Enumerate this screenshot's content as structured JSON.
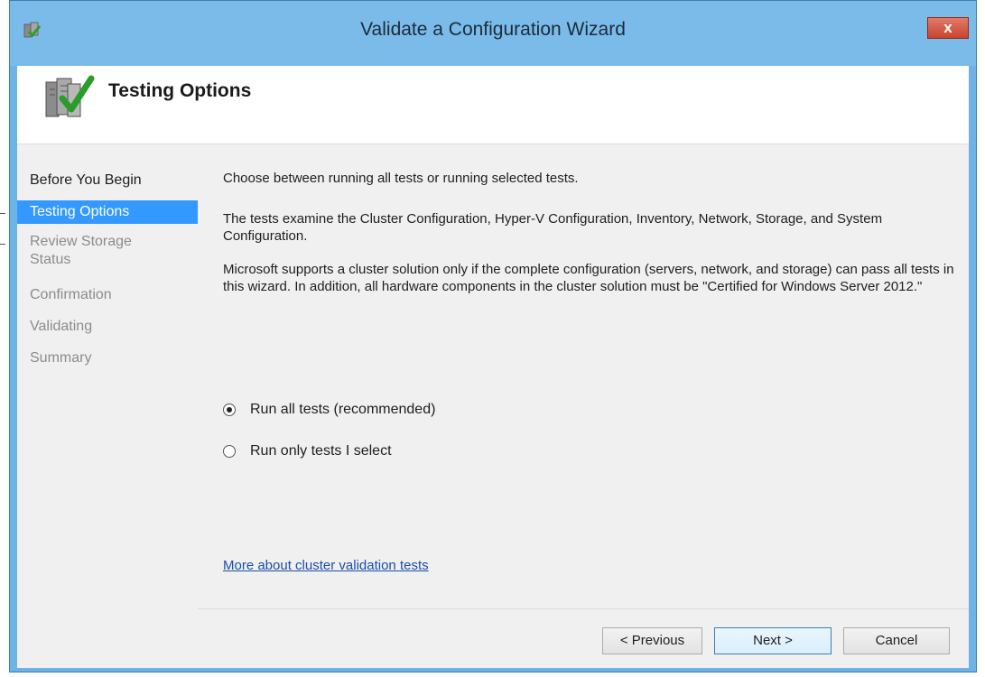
{
  "window": {
    "title": "Validate a Configuration Wizard",
    "close_label": "x"
  },
  "header": {
    "title": "Testing Options"
  },
  "nav": {
    "items": [
      {
        "label": "Before You Begin",
        "state": "completed"
      },
      {
        "label": "Testing Options",
        "state": "active"
      },
      {
        "label": "Review Storage\nStatus",
        "state": "pending"
      },
      {
        "label": "Confirmation",
        "state": "pending"
      },
      {
        "label": "Validating",
        "state": "pending"
      },
      {
        "label": "Summary",
        "state": "pending"
      }
    ]
  },
  "content": {
    "intro": "Choose between running all tests or running selected tests.",
    "tests_description": "The tests examine the Cluster Configuration, Hyper-V Configuration, Inventory, Network, Storage, and System Configuration.",
    "support_statement": "Microsoft supports a cluster solution only if the complete configuration (servers, network, and storage) can pass all tests in this wizard. In addition, all hardware components in the cluster solution must be \"Certified for Windows Server 2012.\"",
    "options": [
      {
        "label": "Run all tests (recommended)",
        "checked": true
      },
      {
        "label": "Run only tests I select",
        "checked": false
      }
    ],
    "help_link": "More about cluster validation tests"
  },
  "buttons": {
    "previous": "< Previous",
    "next": "Next >",
    "cancel": "Cancel"
  },
  "colors": {
    "titlebar": "#7bbbe9",
    "nav_active": "#3399ff",
    "link": "#1a4fa8",
    "close": "#c7452f"
  }
}
